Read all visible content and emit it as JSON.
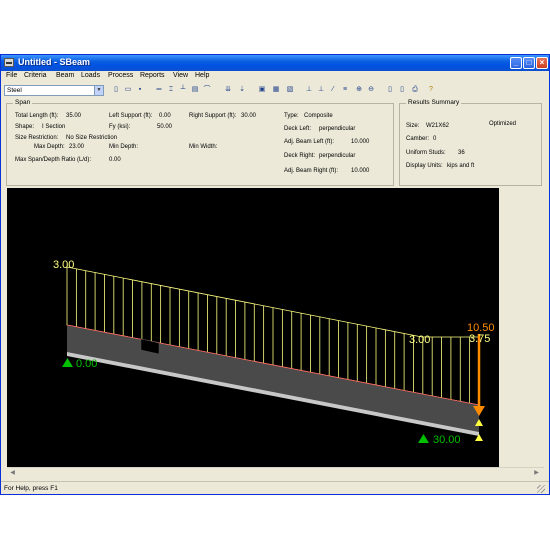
{
  "window": {
    "title": "Untitled - SBeam"
  },
  "menu": [
    "File",
    "Criteria",
    "Beam",
    "Loads",
    "Process",
    "Reports",
    "View",
    "Help"
  ],
  "toolbar": {
    "material": "Steel",
    "icons": [
      "new-file-icon",
      "open-folder-icon",
      "save-icon",
      "beam-icon",
      "section-icon",
      "stud-icon",
      "deck-icon",
      "camber-icon",
      "load-icon",
      "load-alt-icon",
      "view-elevation-icon",
      "view-plan-icon",
      "view-3d-icon",
      "diagram-icon",
      "diagram-alt-icon",
      "line-load-icon",
      "point-load-icon",
      "zoom-in-icon",
      "zoom-out-icon",
      "report-icon",
      "report-detail-icon",
      "print-icon",
      "help-icon"
    ]
  },
  "span": {
    "title": "Span",
    "total_length_label": "Total Length (ft):",
    "total_length": "35.00",
    "left_support_label": "Left Support (ft):",
    "left_support": "0.00",
    "right_support_label": "Right Support (ft):",
    "right_support": "30.00",
    "shape_label": "Shape:",
    "shape": "I Section",
    "fy_label": "Fy (ksi):",
    "fy": "50.00",
    "size_restriction_label": "Size Restriction:",
    "size_restriction": "No Size Restriction",
    "max_depth_label": "Max Depth:",
    "max_depth": "23.00",
    "min_depth_label": "Min Depth:",
    "min_width_label": "Min Width:",
    "max_span_depth_label": "Max Span/Depth Ratio (L/d):",
    "max_span_depth": "0.00",
    "type_label": "Type:",
    "type": "Composite",
    "deck_left_label": "Deck Left:",
    "deck_left": "perpendicular",
    "adj_beam_left_label": "Adj. Beam Left (ft):",
    "adj_beam_left": "10.000",
    "deck_right_label": "Deck Right:",
    "deck_right": "perpendicular",
    "adj_beam_right_label": "Adj. Beam Right (ft):",
    "adj_beam_right": "10.000"
  },
  "results": {
    "title": "Results Summary",
    "size_label": "Size:",
    "size": "W21X62",
    "status": "Optimized",
    "camber_label": "Camber:",
    "camber": "0",
    "studs_label": "Uniform Studs:",
    "studs": "36",
    "units_label": "Display Units:",
    "units": "kips and ft"
  },
  "model": {
    "load_left_label": "3.00",
    "load_right_label": "3.00",
    "point_load_label": "10.50",
    "point_load_ext_label": "3.75",
    "left_support_label": "0.00",
    "right_support_label": "30.00",
    "colors": {
      "load": "#ffff80",
      "point_load": "#ff8c00",
      "support": "#00c000",
      "beam_top": "#c8c8c8",
      "beam_edge": "#ff6060"
    }
  },
  "status": {
    "text": "For Help, press F1"
  }
}
